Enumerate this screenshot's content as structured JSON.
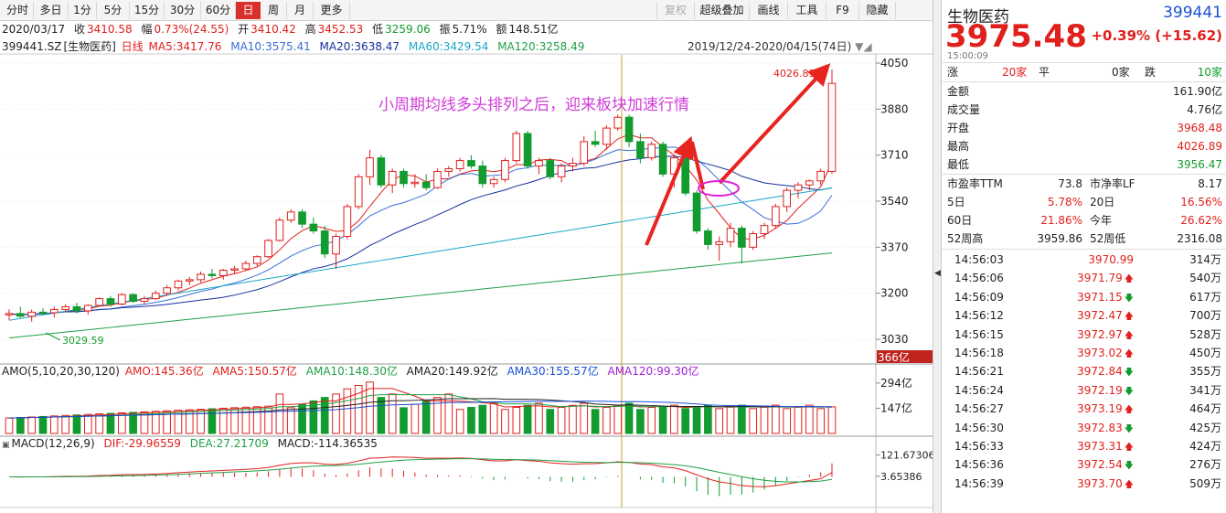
{
  "toolbar": {
    "periods": [
      "分时",
      "多日",
      "1分",
      "5分",
      "15分",
      "30分",
      "60分",
      "日",
      "周",
      "月",
      "更多"
    ],
    "active": "日",
    "right": [
      "复权",
      "超级叠加",
      "画线",
      "工具",
      "F9",
      "隐藏"
    ]
  },
  "info": {
    "date": "2020/03/17",
    "close_label": "收",
    "close": "3410.58",
    "amp_label": "幅",
    "change": "0.73%(24.55)",
    "open_label": "开",
    "open": "3410.42",
    "high_label": "高",
    "high": "3452.53",
    "low_label": "低",
    "low": "3259.06",
    "swing_label": "振",
    "swing": "5.71%",
    "amount_label": "额",
    "amount": "148.51亿"
  },
  "kline": {
    "code": "399441.SZ",
    "name": "[生物医药]",
    "period": "日线",
    "ma5": "MA5:3417.76",
    "ma10": "MA10:3575.41",
    "ma20": "MA20:3638.47",
    "ma60": "MA60:3429.54",
    "ma120": "MA120:3258.49",
    "range": "2019/12/24-2020/04/15(74日)",
    "annotation": "小周期均线多头排列之后，迎来板块加速行情",
    "max_label": "4026.89",
    "min_label": "3029.59",
    "yticks": [
      "4050",
      "3880",
      "3710",
      "3540",
      "3370",
      "3200",
      "3030"
    ],
    "cursor_amount": "366亿"
  },
  "amo": {
    "title": "AMO(5,10,20,30,120)",
    "amo": "AMO:145.36亿",
    "ama5": "AMA5:150.57亿",
    "ama10": "AMA10:148.30亿",
    "ama20": "AMA20:149.92亿",
    "ama30": "AMA30:155.57亿",
    "ama120": "AMA120:99.30亿",
    "yticks": [
      "294亿",
      "147亿"
    ]
  },
  "macd": {
    "title": "MACD(12,26,9)",
    "dif": "DIF:-29.96559",
    "dea": "DEA:27.21709",
    "macd": "MACD:-114.36535",
    "yticks": [
      "121.67306",
      "3.65386"
    ]
  },
  "quote": {
    "name": "生物医药",
    "code": "399441",
    "price": "3975.48",
    "change": "+0.39% (+15.62)",
    "time": "15:00:09",
    "breadth": {
      "up_label": "涨",
      "up": "20家",
      "flat_label": "平",
      "flat": "0家",
      "down_label": "跌",
      "down": "10家"
    },
    "stats": [
      [
        "金额",
        "161.90亿"
      ],
      [
        "成交量",
        "4.76亿"
      ],
      [
        "开盘",
        "3968.48"
      ],
      [
        "最高",
        "4026.89"
      ],
      [
        "最低",
        "3956.47"
      ]
    ],
    "valuation": [
      [
        "市盈率TTM",
        "73.8",
        "市净率LF",
        "8.17"
      ],
      [
        "5日",
        "5.78%",
        "20日",
        "16.56%"
      ],
      [
        "60日",
        "21.86%",
        "今年",
        "26.62%"
      ],
      [
        "52周高",
        "3959.86",
        "52周低",
        "2316.08"
      ]
    ],
    "ticks": [
      [
        "14:56:03",
        "3970.99",
        "",
        "314万"
      ],
      [
        "14:56:06",
        "3971.79",
        "up",
        "540万"
      ],
      [
        "14:56:09",
        "3971.15",
        "down",
        "617万"
      ],
      [
        "14:56:12",
        "3972.47",
        "up",
        "700万"
      ],
      [
        "14:56:15",
        "3972.97",
        "up",
        "528万"
      ],
      [
        "14:56:18",
        "3973.02",
        "up",
        "450万"
      ],
      [
        "14:56:21",
        "3972.84",
        "down",
        "355万"
      ],
      [
        "14:56:24",
        "3972.19",
        "down",
        "341万"
      ],
      [
        "14:56:27",
        "3973.19",
        "up",
        "464万"
      ],
      [
        "14:56:30",
        "3972.83",
        "down",
        "425万"
      ],
      [
        "14:56:33",
        "3973.31",
        "up",
        "424万"
      ],
      [
        "14:56:36",
        "3972.54",
        "down",
        "276万"
      ],
      [
        "14:56:39",
        "3973.70",
        "up",
        "509万"
      ]
    ]
  },
  "chart_data": {
    "type": "candlestick",
    "x_count": 74,
    "ylim": [
      3030,
      4050
    ],
    "ohlc": [
      [
        3120,
        3140,
        3100,
        3125
      ],
      [
        3125,
        3150,
        3110,
        3115
      ],
      [
        3115,
        3140,
        3095,
        3130
      ],
      [
        3130,
        3145,
        3120,
        3128
      ],
      [
        3128,
        3150,
        3110,
        3140
      ],
      [
        3140,
        3160,
        3130,
        3150
      ],
      [
        3150,
        3165,
        3125,
        3135
      ],
      [
        3135,
        3160,
        3120,
        3155
      ],
      [
        3155,
        3185,
        3150,
        3180
      ],
      [
        3180,
        3190,
        3150,
        3160
      ],
      [
        3160,
        3200,
        3155,
        3195
      ],
      [
        3195,
        3200,
        3165,
        3170
      ],
      [
        3170,
        3190,
        3160,
        3180
      ],
      [
        3180,
        3210,
        3175,
        3200
      ],
      [
        3200,
        3230,
        3190,
        3220
      ],
      [
        3220,
        3250,
        3210,
        3245
      ],
      [
        3245,
        3260,
        3230,
        3250
      ],
      [
        3250,
        3280,
        3240,
        3270
      ],
      [
        3270,
        3290,
        3255,
        3265
      ],
      [
        3265,
        3290,
        3250,
        3285
      ],
      [
        3285,
        3300,
        3270,
        3290
      ],
      [
        3290,
        3320,
        3285,
        3310
      ],
      [
        3310,
        3340,
        3300,
        3335
      ],
      [
        3335,
        3400,
        3330,
        3395
      ],
      [
        3395,
        3480,
        3390,
        3470
      ],
      [
        3470,
        3510,
        3460,
        3500
      ],
      [
        3500,
        3510,
        3440,
        3455
      ],
      [
        3455,
        3480,
        3420,
        3430
      ],
      [
        3430,
        3450,
        3330,
        3345
      ],
      [
        3345,
        3420,
        3290,
        3410
      ],
      [
        3410,
        3530,
        3400,
        3520
      ],
      [
        3520,
        3640,
        3510,
        3630
      ],
      [
        3630,
        3730,
        3600,
        3700
      ],
      [
        3700,
        3710,
        3590,
        3600
      ],
      [
        3600,
        3660,
        3570,
        3650
      ],
      [
        3650,
        3660,
        3590,
        3605
      ],
      [
        3605,
        3640,
        3590,
        3610
      ],
      [
        3610,
        3640,
        3580,
        3590
      ],
      [
        3590,
        3660,
        3585,
        3650
      ],
      [
        3650,
        3670,
        3630,
        3660
      ],
      [
        3660,
        3700,
        3650,
        3690
      ],
      [
        3690,
        3710,
        3660,
        3670
      ],
      [
        3670,
        3690,
        3590,
        3605
      ],
      [
        3605,
        3630,
        3590,
        3620
      ],
      [
        3620,
        3700,
        3610,
        3690
      ],
      [
        3690,
        3800,
        3680,
        3790
      ],
      [
        3790,
        3800,
        3660,
        3670
      ],
      [
        3670,
        3700,
        3640,
        3690
      ],
      [
        3690,
        3700,
        3620,
        3630
      ],
      [
        3630,
        3680,
        3610,
        3670
      ],
      [
        3670,
        3700,
        3650,
        3680
      ],
      [
        3680,
        3780,
        3670,
        3760
      ],
      [
        3760,
        3800,
        3740,
        3750
      ],
      [
        3750,
        3820,
        3730,
        3810
      ],
      [
        3810,
        3860,
        3800,
        3850
      ],
      [
        3850,
        3860,
        3740,
        3760
      ],
      [
        3760,
        3790,
        3680,
        3700
      ],
      [
        3700,
        3760,
        3690,
        3750
      ],
      [
        3750,
        3760,
        3630,
        3640
      ],
      [
        3640,
        3710,
        3590,
        3700
      ],
      [
        3700,
        3710,
        3560,
        3570
      ],
      [
        3570,
        3580,
        3420,
        3430
      ],
      [
        3430,
        3440,
        3360,
        3380
      ],
      [
        3380,
        3410,
        3320,
        3390
      ],
      [
        3390,
        3460,
        3370,
        3440
      ],
      [
        3440,
        3450,
        3310,
        3370
      ],
      [
        3370,
        3430,
        3360,
        3420
      ],
      [
        3420,
        3460,
        3400,
        3450
      ],
      [
        3450,
        3530,
        3440,
        3520
      ],
      [
        3520,
        3590,
        3500,
        3580
      ],
      [
        3580,
        3610,
        3550,
        3600
      ],
      [
        3600,
        3620,
        3580,
        3615
      ],
      [
        3615,
        3660,
        3600,
        3650
      ],
      [
        3650,
        4026.89,
        3640,
        3975
      ]
    ]
  }
}
